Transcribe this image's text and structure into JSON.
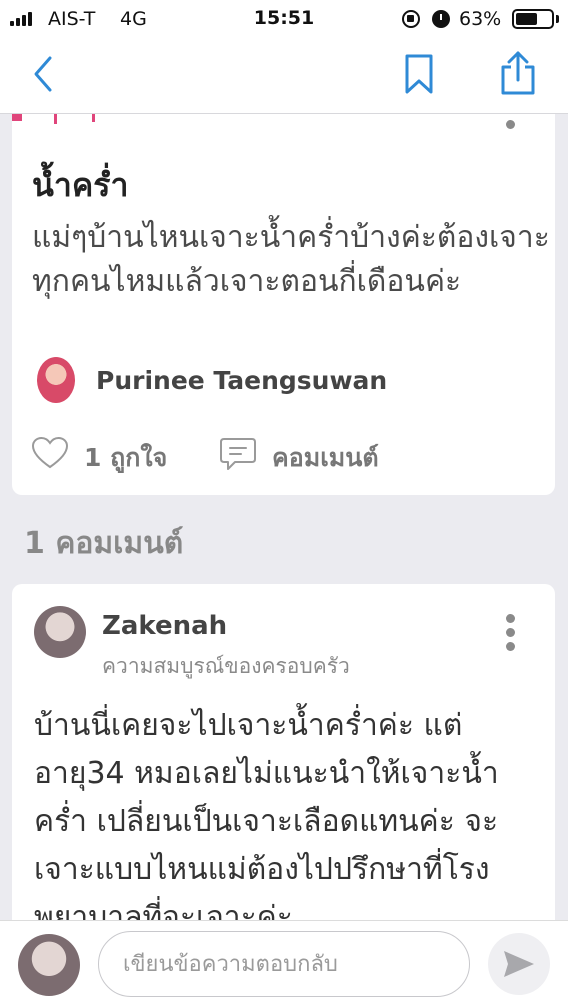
{
  "status_bar": {
    "carrier": "AIS-T",
    "network": "4G",
    "time": "15:51",
    "battery_percent": "63%",
    "battery_level": 0.63,
    "icons": [
      "signal-bars-icon",
      "orientation-lock-icon",
      "alarm-icon",
      "battery-icon"
    ]
  },
  "nav": {
    "icons": [
      "back-chevron-icon",
      "bookmark-icon",
      "share-icon"
    ],
    "accent_color": "#2f8ad6"
  },
  "post": {
    "title": "น้ำคร่ำ",
    "body": "แม่ๆบ้านไหนเจาะน้ำคร่ำบ้างค่ะต้องเจาะทุกคนไหมแล้วเจาะตอนกี่เดือนค่ะ",
    "author": "Purinee Taengsuwan",
    "like_count_label": "1 ถูกใจ",
    "comment_label": "คอมเมนต์",
    "accent_color": "#e0457b"
  },
  "comments_section": {
    "heading": "1 คอมเมนต์"
  },
  "comment": {
    "author": "Zakenah",
    "subtitle": "ความสมบูรณ์ของครอบครัว",
    "body": "บ้านนี่เคยจะไปเจาะน้ำคร่ำค่ะ แต่อายุ34 หมอเลยไม่แนะนำให้เจาะน้ำคร่ำ เปลี่ยนเป็นเจาะเลือดแทนค่ะ จะเจาะแบบไหนแม่ต้องไปปรึกษาที่โรงพยาบาลที่จะเจาะค่ะ"
  },
  "reply": {
    "placeholder": "เขียนข้อความตอบกลับ",
    "value": ""
  }
}
